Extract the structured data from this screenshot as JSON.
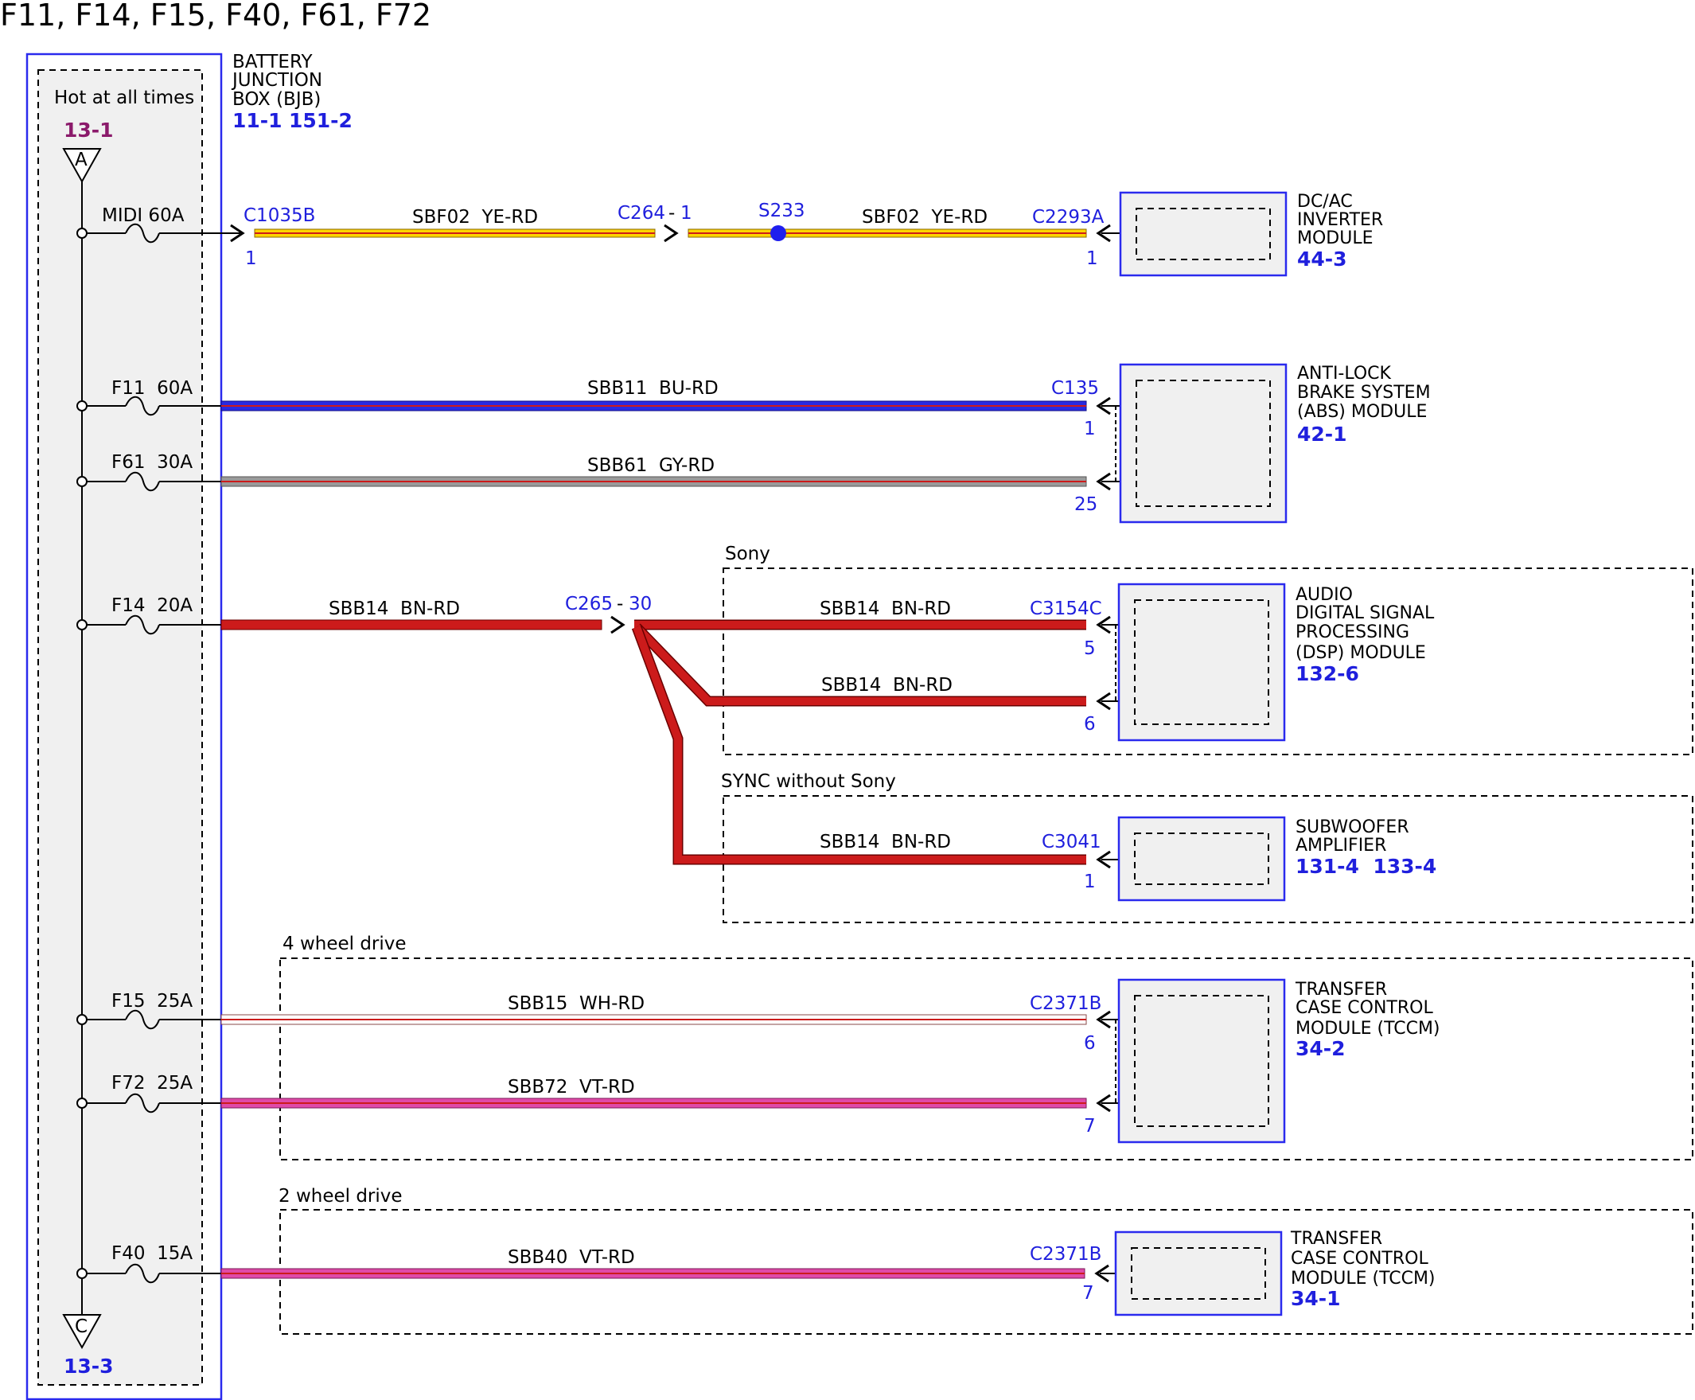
{
  "title": "F11, F14, F15, F40, F61, F72",
  "colors": {
    "frame_blue": "#2a2aee",
    "label_blue": "#1f1fdd",
    "ref_purple": "#8b1a6b",
    "wire_yellow": "#ffd400",
    "wire_blue": "#2a2ae0",
    "wire_red": "#cc1b1b",
    "wire_gray": "#9a9a9a",
    "wire_white": "#ffffff",
    "wire_violet": "#e04aa8"
  },
  "bjb": {
    "name": [
      "BATTERY",
      "JUNCTION",
      "BOX (BJB)"
    ],
    "refs": [
      "11-1",
      "151-2"
    ],
    "hot_label": "Hot at all times",
    "top_ref": "13-1",
    "top_connector": "A",
    "bottom_connector": "C",
    "bottom_ref": "13-3"
  },
  "fuses": [
    {
      "id": "midi",
      "label": "MIDI 60A"
    },
    {
      "id": "f11",
      "label": "F11  60A"
    },
    {
      "id": "f61",
      "label": "F61  30A"
    },
    {
      "id": "f14",
      "label": "F14  20A"
    },
    {
      "id": "f15",
      "label": "F15  25A"
    },
    {
      "id": "f72",
      "label": "F72  25A"
    },
    {
      "id": "f40",
      "label": "F40  15A"
    }
  ],
  "circuits": {
    "sbf02": {
      "circuit": "SBF02  YE-RD",
      "conn_start": "C1035B",
      "pin_start": "1",
      "inline_conn": "C264",
      "inline_pin": "1",
      "splice": "S233",
      "conn_end": "C2293A",
      "pin_end": "1"
    },
    "sbb11": {
      "circuit": "SBB11  BU-RD",
      "conn": "C135",
      "pin": "1"
    },
    "sbb61": {
      "circuit": "SBB61  GY-RD",
      "pin": "25"
    },
    "sbb14": {
      "circuit": "SBB14  BN-RD",
      "inline_conn": "C265",
      "inline_pin": "30",
      "dsp_conn": "C3154C",
      "dsp_pin_a": "5",
      "dsp_pin_b": "6",
      "sub_conn": "C3041",
      "sub_pin": "1"
    },
    "sbb15": {
      "circuit": "SBB15  WH-RD",
      "conn": "C2371B",
      "pin": "6"
    },
    "sbb72": {
      "circuit": "SBB72  VT-RD",
      "pin": "7"
    },
    "sbb40": {
      "circuit": "SBB40  VT-RD",
      "conn": "C2371B",
      "pin": "7"
    }
  },
  "option_groups": {
    "sony": "Sony",
    "sync": "SYNC without Sony",
    "awd": "4 wheel drive",
    "twd": "2 wheel drive"
  },
  "modules": {
    "inverter": {
      "name": [
        "DC/AC",
        "INVERTER",
        "MODULE"
      ],
      "ref": "44-3"
    },
    "abs": {
      "name": [
        "ANTI-LOCK",
        "BRAKE SYSTEM",
        "(ABS) MODULE"
      ],
      "ref": "42-1"
    },
    "dsp": {
      "name": [
        "AUDIO",
        "DIGITAL SIGNAL",
        "PROCESSING",
        "(DSP) MODULE"
      ],
      "ref": "132-6"
    },
    "subwoofer": {
      "name": [
        "SUBWOOFER",
        "AMPLIFIER"
      ],
      "ref": "131-4  133-4"
    },
    "tccm_4wd": {
      "name": [
        "TRANSFER",
        "CASE CONTROL",
        "MODULE (TCCM)"
      ],
      "ref": "34-2"
    },
    "tccm_2wd": {
      "name": [
        "TRANSFER",
        "CASE CONTROL",
        "MODULE (TCCM)"
      ],
      "ref": "34-1"
    }
  }
}
